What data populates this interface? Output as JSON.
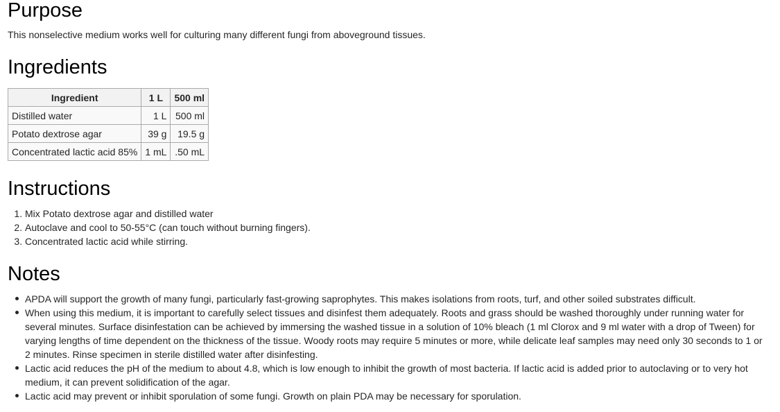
{
  "purpose": {
    "title": "Purpose",
    "text": "This nonselective medium works well for culturing many different fungi from aboveground tissues."
  },
  "ingredients": {
    "title": "Ingredients",
    "headers": [
      "Ingredient",
      "1 L",
      "500 ml"
    ],
    "rows": [
      [
        "Distilled water",
        "1 L",
        "500 ml"
      ],
      [
        "Potato dextrose agar",
        "39 g",
        "19.5 g"
      ],
      [
        "Concentrated lactic acid 85%",
        "1 mL",
        ".50 mL"
      ]
    ]
  },
  "instructions": {
    "title": "Instructions",
    "steps": [
      "Mix Potato dextrose agar and distilled water",
      "Autoclave and cool to 50-55°C (can touch without burning fingers).",
      "Concentrated lactic acid while stirring."
    ]
  },
  "notes": {
    "title": "Notes",
    "items": [
      "APDA will support the growth of many fungi, particularly fast-growing saprophytes. This makes isolations from roots, turf, and other soiled substrates difficult.",
      "When using this medium, it is important to carefully select tissues and disinfest them adequately. Roots and grass should be washed thoroughly under running water for several minutes. Surface disinfestation can be achieved by immersing the washed tissue in a solution of 10% bleach (1 ml Clorox and 9 ml water with a drop of Tween) for varying lengths of time dependent on the thickness of the tissue. Woody roots may require 5 minutes or more, while delicate leaf samples may need only 30 seconds to 1 or 2 minutes. Rinse specimen in sterile distilled water after disinfesting.",
      "Lactic acid reduces the pH of the medium to about 4.8, which is low enough to inhibit the growth of most bacteria. If lactic acid is added prior to autoclaving or to very hot medium, it can prevent solidification of the agar.",
      "Lactic acid may prevent or inhibit sporulation of some fungi. Growth on plain PDA may be necessary for sporulation."
    ]
  }
}
